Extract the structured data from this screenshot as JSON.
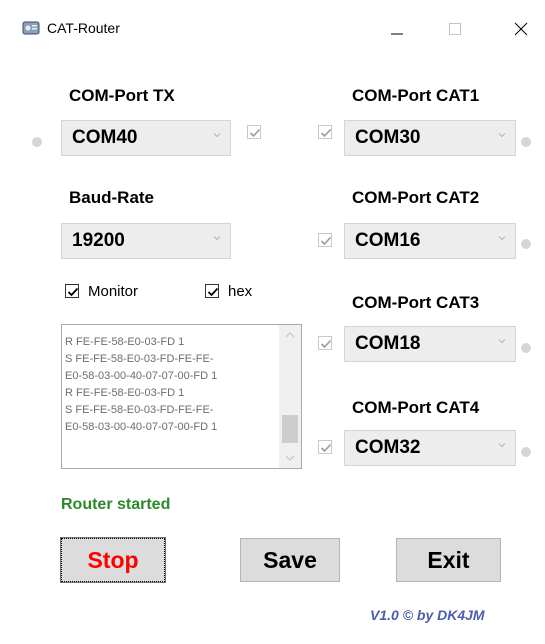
{
  "window": {
    "title": "CAT-Router",
    "icons": [
      "app-icon",
      "minimize-icon",
      "maximize-icon",
      "close-icon"
    ]
  },
  "tx": {
    "label": "COM-Port TX",
    "port": "COM40",
    "enabled": true
  },
  "baud": {
    "label": "Baud-Rate",
    "value": "19200"
  },
  "options": {
    "monitor_label": "Monitor",
    "monitor_checked": true,
    "hex_label": "hex",
    "hex_checked": true
  },
  "log": {
    "lines": [
      "R FE-FE-58-E0-03-FD 1",
      "S FE-FE-58-E0-03-FD-FE-FE-",
      "E0-58-03-00-40-07-07-00-FD 1",
      "R FE-FE-58-E0-03-FD 1",
      "S FE-FE-58-E0-03-FD-FE-FE-",
      "E0-58-03-00-40-07-07-00-FD 1"
    ]
  },
  "cats": [
    {
      "label": "COM-Port CAT1",
      "port": "COM30",
      "enabled": true
    },
    {
      "label": "COM-Port CAT2",
      "port": "COM16",
      "enabled": true
    },
    {
      "label": "COM-Port CAT3",
      "port": "COM18",
      "enabled": true
    },
    {
      "label": "COM-Port CAT4",
      "port": "COM32",
      "enabled": true
    }
  ],
  "status": {
    "text": "Router started",
    "color": "#2a8a2a"
  },
  "buttons": {
    "stop": "Stop",
    "stop_color": "#ff0000",
    "save": "Save",
    "exit": "Exit"
  },
  "footer": {
    "version": "V1.0 © by DK4JM"
  }
}
